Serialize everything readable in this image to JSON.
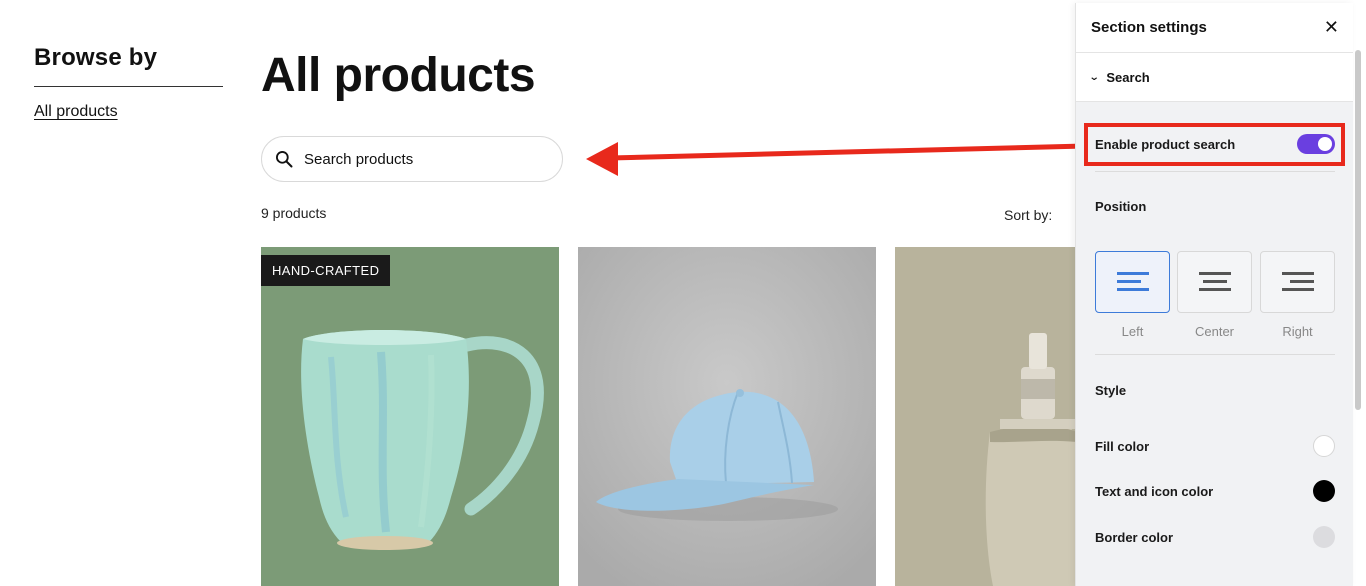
{
  "browse": {
    "title": "Browse by",
    "link": "All products"
  },
  "main": {
    "title": "All products",
    "search_placeholder": "Search products",
    "count": "9 products",
    "sort_label": "Sort by:"
  },
  "products": [
    {
      "badge": "HAND-CRAFTED",
      "image": "mug"
    },
    {
      "image": "cap"
    },
    {
      "image": "bottle"
    }
  ],
  "panel": {
    "title": "Section settings",
    "section": "Search",
    "enable_label": "Enable product search",
    "enable_on": true,
    "position_label": "Position",
    "positions": [
      "Left",
      "Center",
      "Right"
    ],
    "position_selected": "Left",
    "style_label": "Style",
    "fill_label": "Fill color",
    "fill_color": "#ffffff",
    "text_icon_label": "Text and icon color",
    "text_icon_color": "#000000",
    "border_label": "Border color",
    "border_color": "#dcdcdf"
  },
  "colors": {
    "accent": "#6a3fe0",
    "annotation": "#e8291c",
    "selected": "#3d7bd9"
  },
  "icons": {
    "search": "search-icon",
    "close": "close-icon",
    "chevron": "chevron-down-icon"
  }
}
